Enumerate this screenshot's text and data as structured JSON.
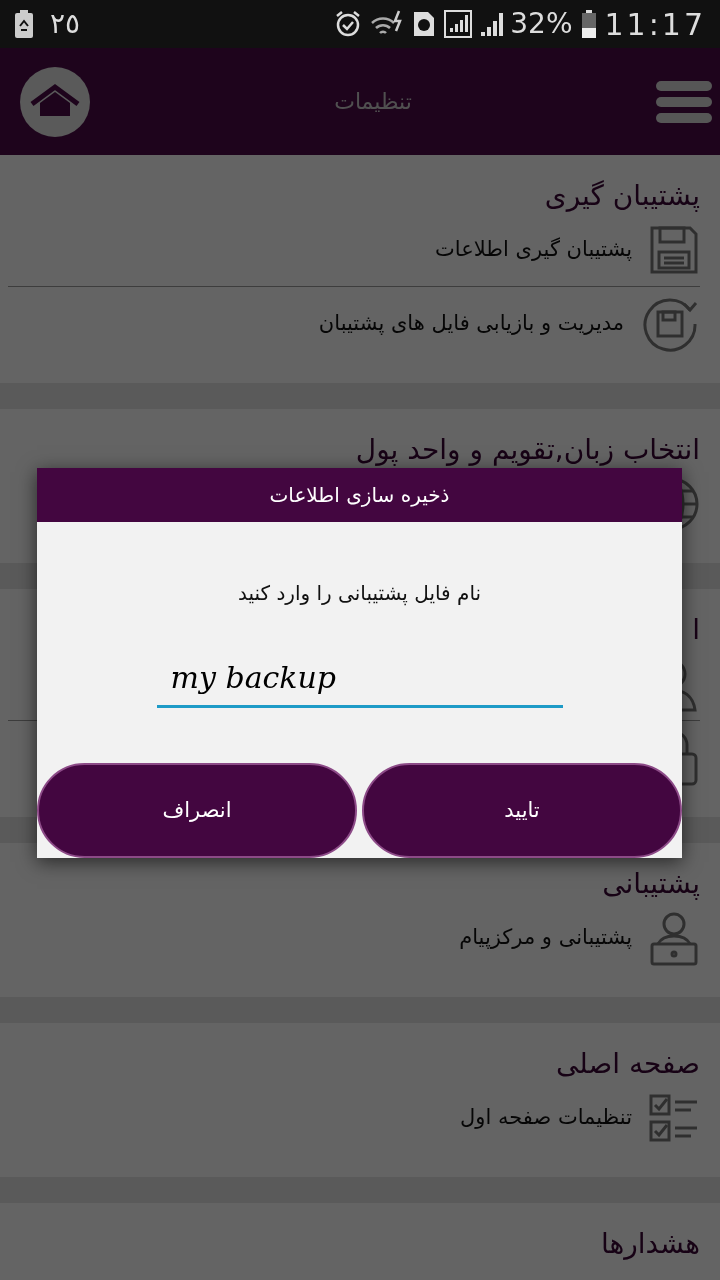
{
  "status_bar": {
    "date": "٢٥",
    "battery_percent": "32%",
    "time": "11:17"
  },
  "header": {
    "title": "تنظیمات"
  },
  "sections": [
    {
      "title": "پشتیبان گیری",
      "items": [
        {
          "kind": "floppy",
          "label": "پشتیبان گیری اطلاعات"
        },
        {
          "kind": "restore",
          "label": "مدیریت و بازیابی فایل های پشتیبان"
        }
      ]
    },
    {
      "title": "انتخاب زبان,تقویم و واحد پول",
      "items": [
        {
          "kind": "globe"
        }
      ]
    },
    {
      "title": "ا",
      "items": [
        {
          "kind": "person"
        },
        {
          "kind": "lock"
        }
      ]
    },
    {
      "title": "پشتیبانی",
      "items": [
        {
          "kind": "support",
          "label": "پشتیبانی و مرکزپیام"
        }
      ]
    },
    {
      "title": "صفحه اصلی",
      "items": [
        {
          "kind": "checklist",
          "label": "تنظیمات صفحه اول"
        }
      ]
    },
    {
      "title": "هشدارها"
    }
  ],
  "dialog": {
    "title": "ذخیره سازی اطلاعات",
    "prompt": "نام فایل پشتیبانی را وارد کنید",
    "value": "my backup",
    "buttons": [
      "تایید",
      "انصراف"
    ]
  }
}
